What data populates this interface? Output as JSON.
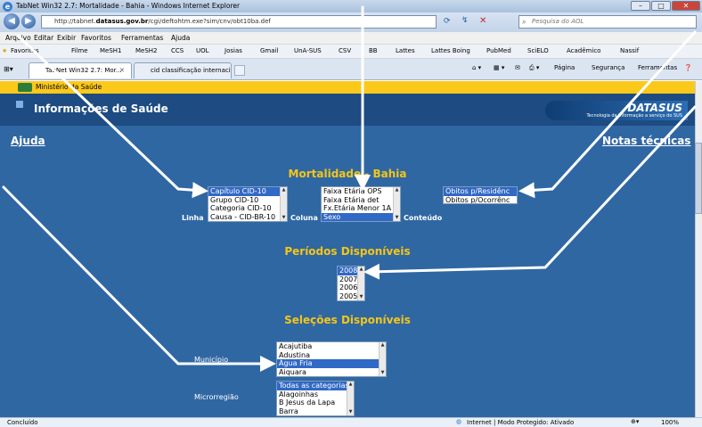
{
  "window": {
    "title": "TabNet Win32 2.7: Mortalidade - Bahia - Windows Internet Explorer"
  },
  "address": {
    "url_pre": "http://tabnet.",
    "url_domain": "datasus.gov.br",
    "url_post": "/cgi/deftohtm.exe?sim/cnv/obt10ba.def",
    "search_placeholder": "Pesquisa do AOL"
  },
  "menu": [
    "Arquivo",
    "Editar",
    "Exibir",
    "Favoritos",
    "Ferramentas",
    "Ajuda"
  ],
  "favorites": {
    "label": "Favoritos",
    "items": [
      "Filme",
      "MeSH1",
      "MeSH2",
      "CCS",
      "UOL",
      "Josias",
      "Gmail",
      "UnA-SUS",
      "CSV",
      "BB",
      "Lattes",
      "Lattes Boing",
      "PubMed",
      "SciELO",
      "Acadêmico",
      "Nassif"
    ]
  },
  "tabs": [
    "TabNet Win32 2.7: Mor...",
    "cid classificação internacio..."
  ],
  "tab_tools": {
    "page": "Página",
    "security": "Segurança",
    "tools": "Ferramentas"
  },
  "ministry_label": "Ministério da Saúde",
  "header": {
    "title": "Informações de Saúde",
    "logo": "DATASUS",
    "logo_sub": "Tecnologia da Informação a serviço do SUS"
  },
  "links": {
    "help": "Ajuda",
    "notes": "Notas técnicas"
  },
  "page_title": "Mortalidade - Bahia",
  "fields": {
    "linha_label": "Linha",
    "linha_options": [
      "Capítulo CID-10",
      "Grupo CID-10",
      "Categoria CID-10",
      "Causa - CID-BR-10"
    ],
    "coluna_label": "Coluna",
    "coluna_options": [
      "Faixa Etária OPS",
      "Faixa Etária det",
      "Fx.Etária Menor 1A",
      "Sexo"
    ],
    "conteudo_label": "Conteúdo",
    "conteudo_options": [
      "Óbitos p/Residênc",
      "Óbitos p/Ocorrênc"
    ]
  },
  "periods": {
    "title": "Períodos Disponíveis",
    "options": [
      "2008",
      "2007",
      "2006",
      "2005"
    ]
  },
  "selections": {
    "title": "Seleções Disponíveis",
    "municipio_label": "Município",
    "municipio_options": [
      "Acajutiba",
      "Adustina",
      "Água Fria",
      "Aiquara"
    ],
    "microrregiao_label": "Microrregião",
    "microrregiao_options": [
      "Todas as categorias",
      "Alagoinhas",
      "B Jesus da Lapa",
      "Barra"
    ]
  },
  "status": {
    "left": "Concluído",
    "zone": "Internet | Modo Protegido: Ativado",
    "zoom": "100%"
  }
}
